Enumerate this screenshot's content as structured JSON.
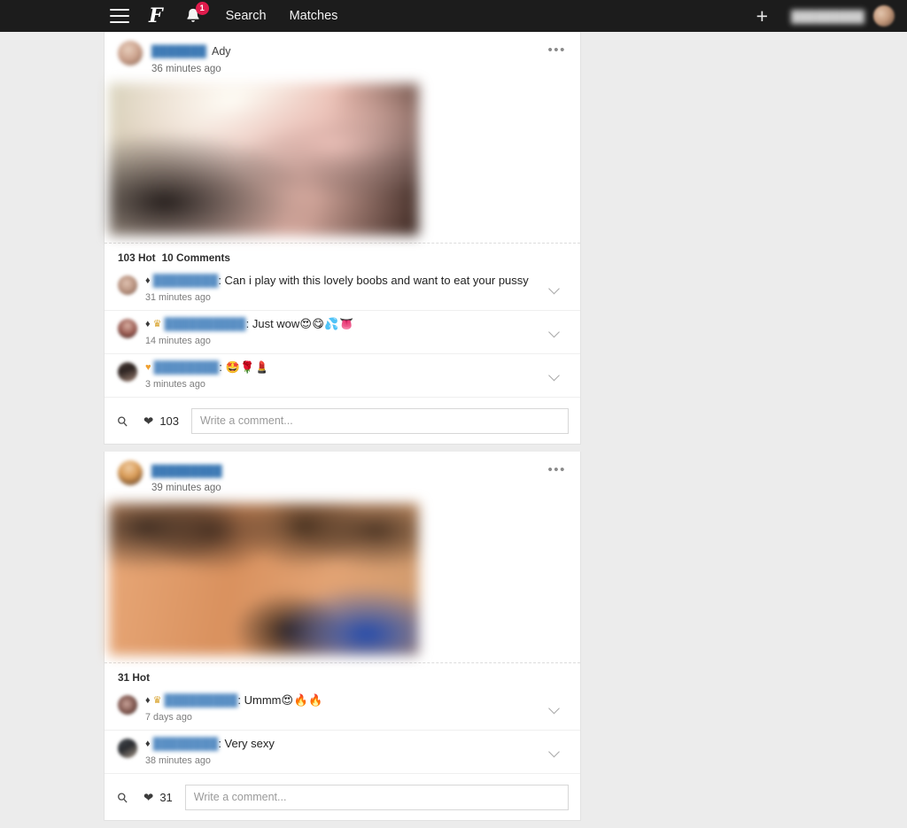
{
  "topbar": {
    "menu_icon": "hamburger-icon",
    "brand_logo": "F",
    "bell_icon": "bell-icon",
    "bell_badge": "1",
    "links": [
      {
        "label": "Search"
      },
      {
        "label": "Matches"
      }
    ],
    "plus_label": "+",
    "account_name": "█████████",
    "avatar_icon": "user-avatar"
  },
  "theme": {
    "nav_background": "#1c1c1c",
    "page_background": "#ececec",
    "card_background": "#ffffff",
    "badge_red": "#e01b4c",
    "link_blue": "#3e7ab5"
  },
  "composer_defaults": {
    "placeholder": "Write a comment...",
    "pin_icon": "pin-icon",
    "heart_icon": "heart-icon"
  },
  "posts": [
    {
      "author_username": "███████",
      "author_realname": "Ady",
      "timestamp": "36 minutes ago",
      "more_label": "•••",
      "stats_hot": "103 Hot",
      "stats_comments": "10 Comments",
      "like_count": "103",
      "composer_placeholder": "Write a comment...",
      "comments": [
        {
          "badges": [
            "gem"
          ],
          "username": "████████",
          "text": "Can i play with this lovely boobs and want to eat your pussy",
          "emoji": "",
          "timestamp": "31 minutes ago"
        },
        {
          "badges": [
            "gem",
            "crown"
          ],
          "username": "██████████",
          "text": "Just wow",
          "emoji": "😍😋💦👅",
          "timestamp": "14 minutes ago"
        },
        {
          "badges": [
            "envelope"
          ],
          "username": "████████",
          "text": "",
          "emoji": "🤩🌹💄",
          "timestamp": "3 minutes ago"
        }
      ]
    },
    {
      "author_username": "█████████",
      "author_realname": "",
      "timestamp": "39 minutes ago",
      "more_label": "•••",
      "stats_hot": "31 Hot",
      "stats_comments": "",
      "like_count": "31",
      "composer_placeholder": "Write a comment...",
      "comments": [
        {
          "badges": [
            "gem",
            "crown"
          ],
          "username": "█████████",
          "text": "Ummm",
          "emoji": "😍🔥🔥",
          "timestamp": "7 days ago"
        },
        {
          "badges": [
            "gem"
          ],
          "username": "████████",
          "text": "Very sexy",
          "emoji": "",
          "timestamp": "38 minutes ago"
        }
      ]
    }
  ]
}
